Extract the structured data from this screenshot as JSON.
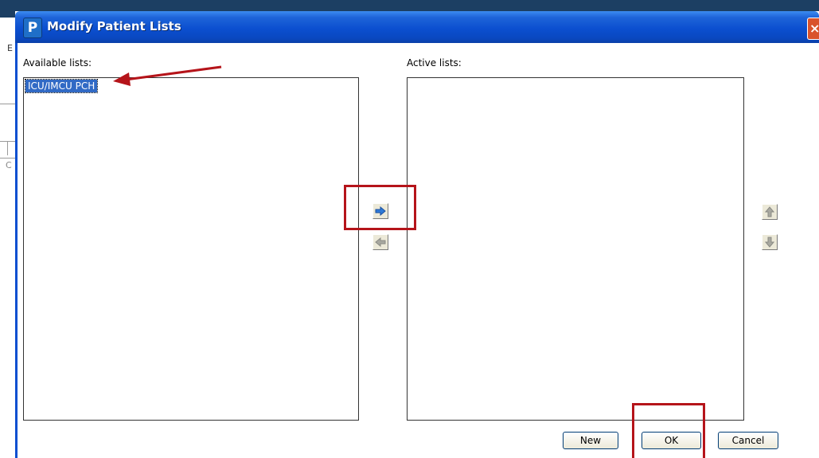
{
  "window": {
    "title": "Modify Patient Lists",
    "icon_letter": "P",
    "close_glyph": "×"
  },
  "available": {
    "label": "Available lists:",
    "items": [
      {
        "label": "ICU/IMCU PCH",
        "selected": true
      }
    ]
  },
  "active": {
    "label": "Active lists:",
    "items": []
  },
  "arrows": {
    "add": {
      "icon": "arrow-right-icon",
      "enabled": true
    },
    "remove": {
      "icon": "arrow-left-icon",
      "enabled": false
    },
    "up": {
      "icon": "arrow-up-icon",
      "enabled": false
    },
    "down": {
      "icon": "arrow-down-icon",
      "enabled": false
    }
  },
  "buttons": {
    "new": "New",
    "ok": "OK",
    "cancel": "Cancel"
  },
  "background": {
    "glyph_1": "E",
    "glyph_2": "C"
  },
  "colors": {
    "annotation": "#b5141a",
    "title_bar": "#0b4fd0",
    "selection": "#316ac5",
    "arrow_blue": "#2f7ad8"
  }
}
